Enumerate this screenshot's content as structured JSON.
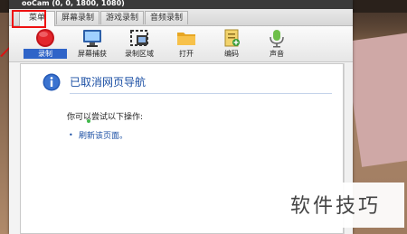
{
  "window": {
    "title": "ooCam (0, 0, 1800, 1080)"
  },
  "menubar": {
    "tabs": [
      "菜单",
      "屏幕录制",
      "游戏录制",
      "音频录制"
    ]
  },
  "toolbar": {
    "record": "录制",
    "screenshot": "屏幕捕获",
    "region": "录制区域",
    "open": "打开",
    "edit": "编码",
    "audio": "声音"
  },
  "page": {
    "title": "已取消网页导航",
    "subtitle": "你可以尝试以下操作:",
    "bullet": "•",
    "refresh_link": "刷新该页面。"
  },
  "watermark": {
    "text": "软件技巧"
  },
  "colors": {
    "link": "#1b4fa4",
    "highlight": "#ee1111",
    "selected_tool": "#2f64c8"
  }
}
